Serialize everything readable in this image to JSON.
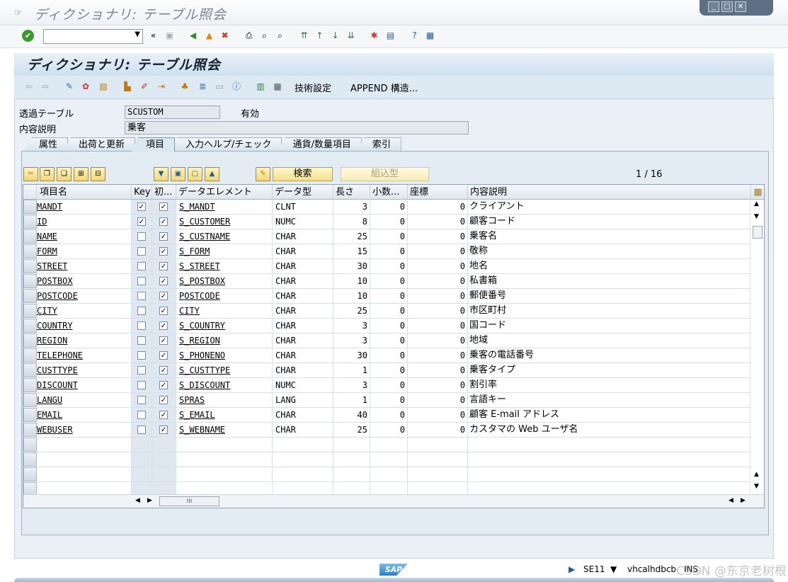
{
  "window": {
    "title": "ディクショナリ: テーブル照会"
  },
  "app": {
    "title": "ディクショナリ: テーブル照会",
    "toolbar": {
      "tech_settings": "技術設定",
      "append": "APPEND 構造..."
    }
  },
  "header": {
    "table_label": "透過テーブル",
    "table_value": "SCUSTOM",
    "status": "有効",
    "desc_label": "内容説明",
    "desc_value": "乗客"
  },
  "tabs": [
    "属性",
    "出荷と更新",
    "項目",
    "入力ヘルプ/チェック",
    "通貨/数量項目",
    "索引"
  ],
  "active_tab": "項目",
  "fields_toolbar": {
    "search": "検索",
    "builtin": "組込型",
    "page_indicator": "1 / 16"
  },
  "grid": {
    "columns": [
      "項目名",
      "Key",
      "初...",
      "データエレメント",
      "データ型",
      "長さ",
      "小数...",
      "座標",
      "内容説明"
    ],
    "rows": [
      {
        "name": "MANDT",
        "key": true,
        "init": true,
        "element": "S_MANDT",
        "type": "CLNT",
        "len": "3",
        "dec": "0",
        "coord": "0",
        "desc": "クライアント"
      },
      {
        "name": "ID",
        "key": true,
        "init": true,
        "element": "S_CUSTOMER",
        "type": "NUMC",
        "len": "8",
        "dec": "0",
        "coord": "0",
        "desc": "顧客コード"
      },
      {
        "name": "NAME",
        "key": false,
        "init": true,
        "element": "S_CUSTNAME",
        "type": "CHAR",
        "len": "25",
        "dec": "0",
        "coord": "0",
        "desc": "乗客名"
      },
      {
        "name": "FORM",
        "key": false,
        "init": true,
        "element": "S_FORM",
        "type": "CHAR",
        "len": "15",
        "dec": "0",
        "coord": "0",
        "desc": "敬称"
      },
      {
        "name": "STREET",
        "key": false,
        "init": true,
        "element": "S_STREET",
        "type": "CHAR",
        "len": "30",
        "dec": "0",
        "coord": "0",
        "desc": "地名"
      },
      {
        "name": "POSTBOX",
        "key": false,
        "init": true,
        "element": "S_POSTBOX",
        "type": "CHAR",
        "len": "10",
        "dec": "0",
        "coord": "0",
        "desc": "私書箱"
      },
      {
        "name": "POSTCODE",
        "key": false,
        "init": true,
        "element": "POSTCODE",
        "type": "CHAR",
        "len": "10",
        "dec": "0",
        "coord": "0",
        "desc": "郵便番号"
      },
      {
        "name": "CITY",
        "key": false,
        "init": true,
        "element": "CITY",
        "type": "CHAR",
        "len": "25",
        "dec": "0",
        "coord": "0",
        "desc": "市区町村"
      },
      {
        "name": "COUNTRY",
        "key": false,
        "init": true,
        "element": "S_COUNTRY",
        "type": "CHAR",
        "len": "3",
        "dec": "0",
        "coord": "0",
        "desc": "国コード"
      },
      {
        "name": "REGION",
        "key": false,
        "init": true,
        "element": "S_REGION",
        "type": "CHAR",
        "len": "3",
        "dec": "0",
        "coord": "0",
        "desc": "地域"
      },
      {
        "name": "TELEPHONE",
        "key": false,
        "init": true,
        "element": "S_PHONENO",
        "type": "CHAR",
        "len": "30",
        "dec": "0",
        "coord": "0",
        "desc": "乗客の電話番号"
      },
      {
        "name": "CUSTTYPE",
        "key": false,
        "init": true,
        "element": "S_CUSTTYPE",
        "type": "CHAR",
        "len": "1",
        "dec": "0",
        "coord": "0",
        "desc": "乗客タイプ"
      },
      {
        "name": "DISCOUNT",
        "key": false,
        "init": true,
        "element": "S_DISCOUNT",
        "type": "NUMC",
        "len": "3",
        "dec": "0",
        "coord": "0",
        "desc": "割引率"
      },
      {
        "name": "LANGU",
        "key": false,
        "init": true,
        "element": "SPRAS",
        "type": "LANG",
        "len": "1",
        "dec": "0",
        "coord": "0",
        "desc": "言語キー"
      },
      {
        "name": "EMAIL",
        "key": false,
        "init": true,
        "element": "S_EMAIL",
        "type": "CHAR",
        "len": "40",
        "dec": "0",
        "coord": "0",
        "desc": "顧客 E-mail アドレス"
      },
      {
        "name": "WEBUSER",
        "key": false,
        "init": true,
        "element": "S_WEBNAME",
        "type": "CHAR",
        "len": "25",
        "dec": "0",
        "coord": "0",
        "desc": "カスタマの Web ユーザ名"
      }
    ],
    "empty_rows": 4
  },
  "status": {
    "tcode": "SE11",
    "server": "vhcalhdbcb",
    "mode": "INS",
    "logo": "SAP"
  },
  "watermark": "CSDN @东京老树根"
}
